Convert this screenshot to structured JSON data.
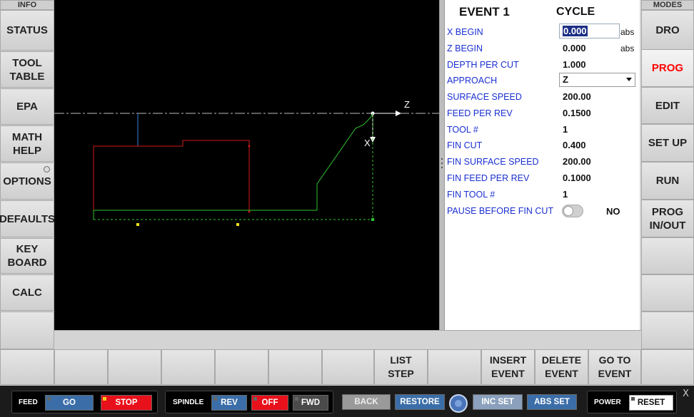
{
  "left_sidebar": {
    "header": "INFO",
    "items": [
      "STATUS",
      "TOOL\nTABLE",
      "EPA",
      "MATH\nHELP",
      "OPTIONS",
      "DEFAULTS",
      "KEY\nBOARD",
      "CALC",
      ""
    ]
  },
  "right_sidebar": {
    "header": "MODES",
    "items": [
      "DRO",
      "PROG",
      "EDIT",
      "SET UP",
      "RUN",
      "PROG\nIN/OUT",
      "",
      "",
      ""
    ],
    "active_color": "#ff0000"
  },
  "canvas": {
    "axis_z_label": "Z",
    "axis_x_label": "X"
  },
  "panel": {
    "event_title": "EVENT 1",
    "event_type": "CYCLE",
    "fields": [
      {
        "label": "X BEGIN",
        "value": "0.000",
        "unit": "abs"
      },
      {
        "label": "Z BEGIN",
        "value": "0.000",
        "unit": "abs"
      },
      {
        "label": "DEPTH PER CUT",
        "value": "1.000",
        "unit": ""
      },
      {
        "label": "APPROACH",
        "value": "Z",
        "unit": ""
      },
      {
        "label": "SURFACE SPEED",
        "value": "200.00",
        "unit": ""
      },
      {
        "label": "FEED PER REV",
        "value": "0.1500",
        "unit": ""
      },
      {
        "label": "TOOL #",
        "value": "1",
        "unit": ""
      },
      {
        "label": "FIN CUT",
        "value": "0.400",
        "unit": ""
      },
      {
        "label": "FIN SURFACE SPEED",
        "value": "200.00",
        "unit": ""
      },
      {
        "label": "FIN FEED PER REV",
        "value": "0.1000",
        "unit": ""
      },
      {
        "label": "FIN TOOL #",
        "value": "1",
        "unit": ""
      },
      {
        "label": "PAUSE BEFORE FIN CUT",
        "value": "NO",
        "unit": ""
      }
    ]
  },
  "softkeys": [
    "",
    "",
    "",
    "",
    "",
    "",
    "",
    "LIST\nSTEP",
    "",
    "INSERT\nEVENT",
    "DELETE\nEVENT",
    "GO TO\nEVENT"
  ],
  "bottom": {
    "feed_label": "FEED",
    "go": "GO",
    "stop": "STOP",
    "spindle_label": "SPINDLE",
    "rev": "REV",
    "off": "OFF",
    "fwd": "FWD",
    "back": "BACK",
    "restore": "RESTORE",
    "inc_set": "INC SET",
    "abs_set": "ABS SET",
    "power_label": "POWER",
    "reset": "RESET",
    "close": "X"
  },
  "colors": {
    "blue_button": "#3b6ea8",
    "red_button": "#e8101a",
    "label_blue": "#1a2fd0"
  }
}
